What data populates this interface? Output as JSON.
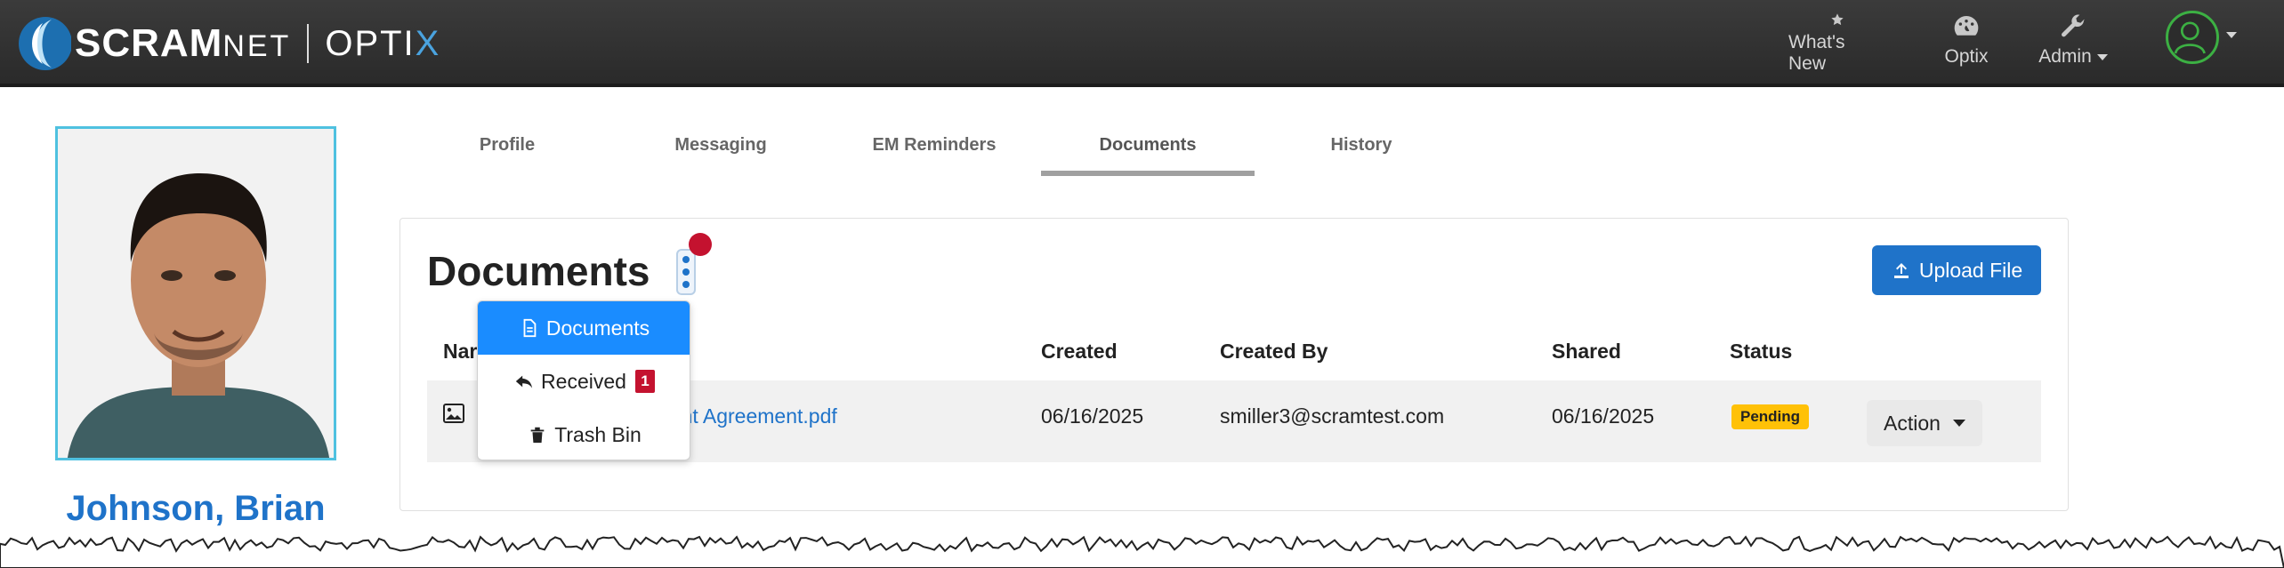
{
  "brand": {
    "name_main": "SCRAM",
    "name_suffix": "NET",
    "product_main": "OPTI",
    "product_x": "X",
    "colors": {
      "accent": "#4aa3df",
      "topbar": "#333333"
    }
  },
  "topnav": {
    "whats_new": {
      "label": "What's New",
      "icon": "star-icon"
    },
    "optix": {
      "label": "Optix",
      "icon": "dashboard-icon"
    },
    "admin": {
      "label": "Admin",
      "icon": "wrench-icon"
    },
    "user_menu": {
      "icon": "user-avatar-icon"
    }
  },
  "profile": {
    "name": "Johnson, Brian",
    "photo": "profile-photo"
  },
  "tabs": [
    {
      "label": "Profile"
    },
    {
      "label": "Messaging"
    },
    {
      "label": "EM Reminders"
    },
    {
      "label": "Documents",
      "active": true
    },
    {
      "label": "History"
    }
  ],
  "documents": {
    "title": "Documents",
    "upload_label": "Upload File",
    "columns": {
      "name": "Nar",
      "created": "Created",
      "created_by": "Created By",
      "shared": "Shared",
      "status": "Status"
    },
    "rows": [
      {
        "name": "pant Agreement.pdf",
        "created": "06/16/2025",
        "created_by": "smiller3@scramtest.com",
        "shared": "06/16/2025",
        "status": "Pending",
        "action_label": "Action"
      }
    ]
  },
  "folder_menu": {
    "items": [
      {
        "label": "Documents",
        "icon": "file-icon",
        "active": true
      },
      {
        "label": "Received",
        "icon": "reply-icon",
        "count": "1"
      },
      {
        "label": "Trash Bin",
        "icon": "trash-icon"
      }
    ]
  }
}
